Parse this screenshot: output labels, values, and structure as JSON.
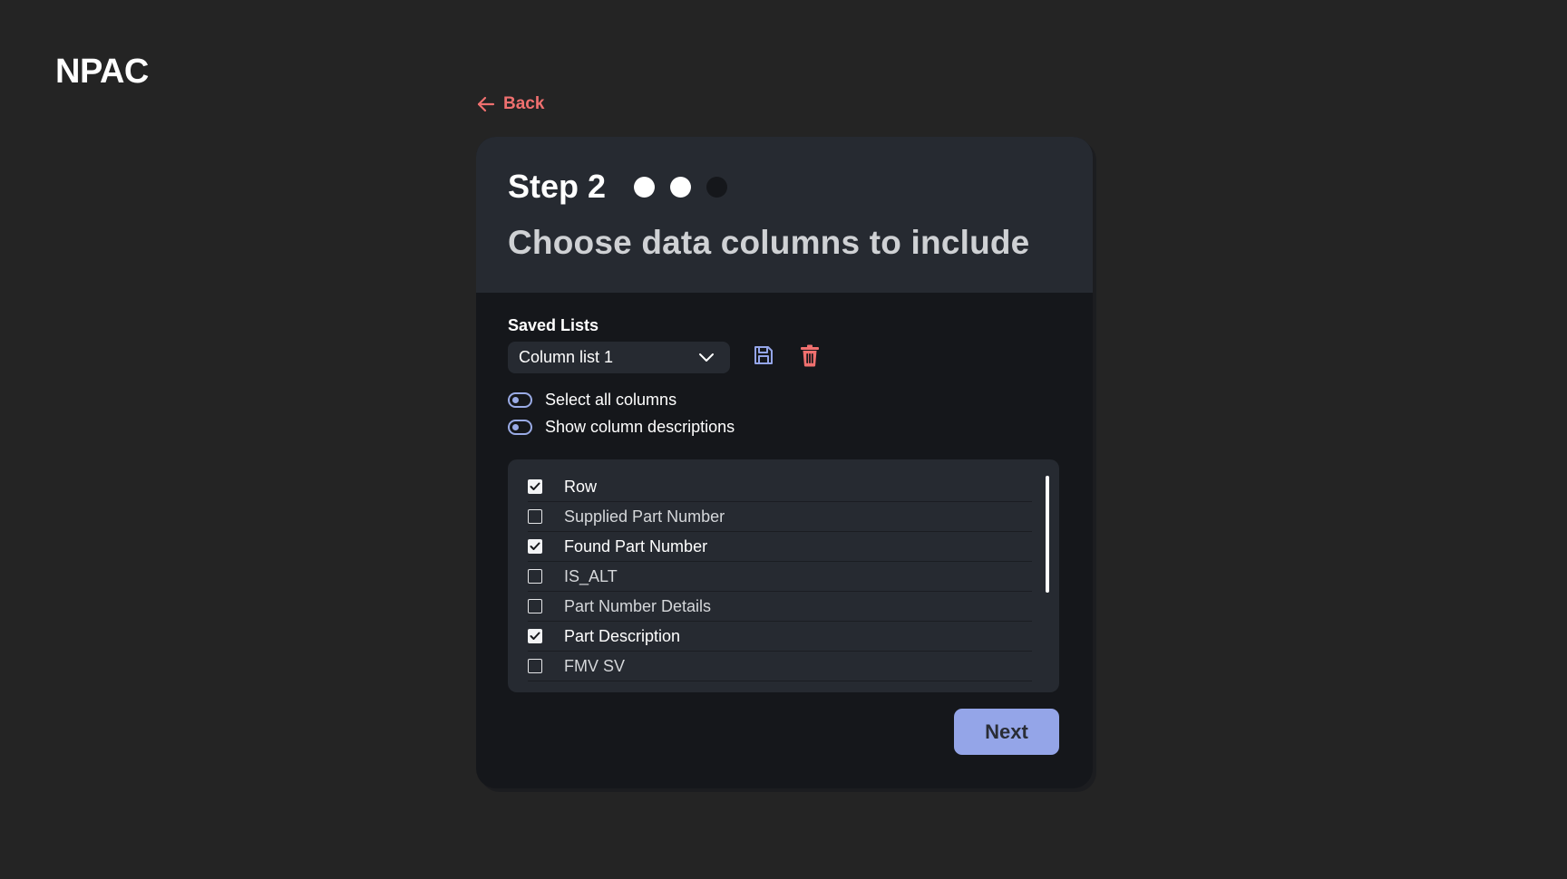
{
  "app": {
    "logo": "NPAC"
  },
  "nav": {
    "back_label": "Back"
  },
  "wizard": {
    "step_title": "Step 2",
    "step_total": 3,
    "step_current": 2,
    "subtitle": "Choose data columns to include"
  },
  "saved_lists": {
    "label": "Saved Lists",
    "selected": "Column list 1"
  },
  "toggles": {
    "select_all": "Select all columns",
    "show_descriptions": "Show column descriptions"
  },
  "columns": [
    {
      "label": "Row",
      "checked": true
    },
    {
      "label": "Supplied Part Number",
      "checked": false
    },
    {
      "label": "Found Part Number",
      "checked": true
    },
    {
      "label": "IS_ALT",
      "checked": false
    },
    {
      "label": "Part Number Details",
      "checked": false
    },
    {
      "label": "Part Description",
      "checked": true
    },
    {
      "label": "FMV SV",
      "checked": false
    }
  ],
  "actions": {
    "next_label": "Next"
  },
  "colors": {
    "background": "#242424",
    "card": "#15171b",
    "card_header": "#262a31",
    "accent": "#94a5e8",
    "danger": "#f0706f"
  },
  "icons": {
    "back": "arrow-left-icon",
    "dropdown": "chevron-down-icon",
    "save": "floppy-disk-icon",
    "delete": "trash-icon",
    "check": "check-icon"
  }
}
